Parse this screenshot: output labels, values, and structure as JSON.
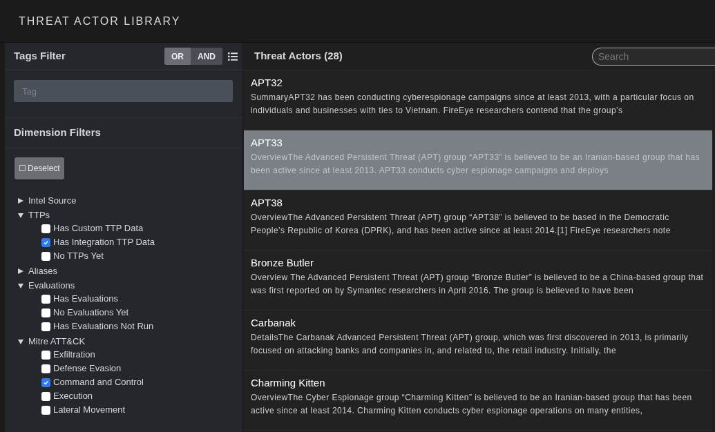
{
  "app": {
    "title": "THREAT ACTOR LIBRARY"
  },
  "tags_filter": {
    "title": "Tags Filter",
    "modes": [
      {
        "label": "OR",
        "selected": false
      },
      {
        "label": "AND",
        "selected": true
      }
    ],
    "tag_field": {
      "placeholder": "Tag"
    }
  },
  "dimension_filters": {
    "title": "Dimension Filters",
    "deselect_button": {
      "icon": "☐",
      "label": "Deselect"
    },
    "tree": [
      {
        "label": "Intel Source",
        "expanded": false
      },
      {
        "label": "TTPs",
        "expanded": true,
        "children": [
          {
            "label": "Has Custom TTP Data",
            "checked": false
          },
          {
            "label": "Has Integration TTP Data",
            "checked": true
          },
          {
            "label": "No TTPs Yet",
            "checked": false
          }
        ]
      },
      {
        "label": "Aliases",
        "expanded": false
      },
      {
        "label": "Evaluations",
        "expanded": true,
        "children": [
          {
            "label": "Has Evaluations",
            "checked": false
          },
          {
            "label": "No Evaluations Yet",
            "checked": false
          },
          {
            "label": "Has Evaluations Not Run",
            "checked": false
          }
        ]
      },
      {
        "label": "Mitre ATT&CK",
        "expanded": true,
        "children": [
          {
            "label": "Exfiltration",
            "checked": false
          },
          {
            "label": "Defense Evasion",
            "checked": false
          },
          {
            "label": "Command and Control",
            "checked": true
          },
          {
            "label": "Execution",
            "checked": false
          },
          {
            "label": "Lateral Movement",
            "checked": false
          }
        ]
      }
    ]
  },
  "threat_actors": {
    "title": "Threat Actors (28)",
    "search": {
      "placeholder": "Search"
    },
    "rows": [
      {
        "name": "APT32",
        "selected": false,
        "description": "SummaryAPT32 has been conducting cyberespionage campaigns since at least 2013, with a particular focus on individuals and businesses with ties to Vietnam. FireEye researchers contend that the group’s"
      },
      {
        "name": "APT33",
        "selected": true,
        "description": "OverviewThe Advanced Persistent Threat (APT) group “APT33” is believed to be an Iranian-based group that has been active since at least 2013. APT33 conducts cyber espionage campaigns and deploys"
      },
      {
        "name": "APT38",
        "selected": false,
        "description": "OverviewThe Advanced Persistent Threat (APT) group “APT38” is believed to be based in the Democratic People’s Republic of Korea (DPRK), and has been active since at least 2014.[1] FireEye researchers note"
      },
      {
        "name": "Bronze Butler",
        "selected": false,
        "description": "Overview The Advanced Persistent Threat (APT) group “Bronze Butler” is believed to be a China-based group that was first reported on by Symantec researchers in April 2016. The group is believed to have been"
      },
      {
        "name": "Carbanak",
        "selected": false,
        "description": "DetailsThe Carbanak Advanced Persistent Threat (APT) group, which was first discovered in 2013, is primarily focused on attacking banks and companies in, and related to, the retail industry. Initially, the"
      },
      {
        "name": "Charming Kitten",
        "selected": false,
        "description": "OverviewThe Cyber Espionage group “Charming Kitten” is believed to be an Iranian-based group that has been active since at least 2014. Charming Kitten conducts cyber espionage operations on many entities,"
      }
    ]
  }
}
